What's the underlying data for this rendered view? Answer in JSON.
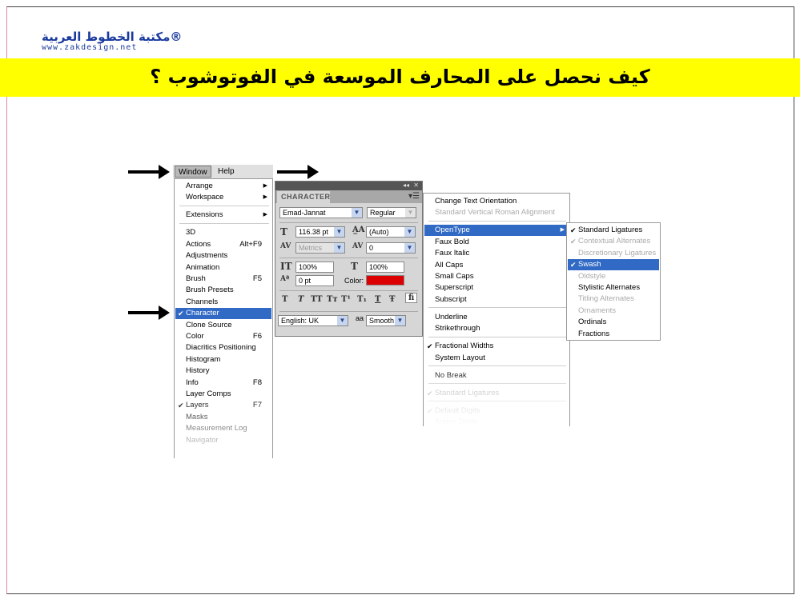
{
  "logo": {
    "arabic": "مكتبة الخطوط العربية®",
    "url": "www.zakdesign.net"
  },
  "banner": {
    "title": "كيف نحصل على المحارف الموسعة في الفوتوشوب ؟",
    "color": "#ffff00"
  },
  "menubar": {
    "window": "Window",
    "help": "Help"
  },
  "window_menu": [
    {
      "label": "Arrange",
      "submenu": true
    },
    {
      "label": "Workspace",
      "submenu": true
    },
    {
      "sep": true
    },
    {
      "label": "Extensions",
      "submenu": true
    },
    {
      "sep": true
    },
    {
      "label": "3D"
    },
    {
      "label": "Actions",
      "shortcut": "Alt+F9"
    },
    {
      "label": "Adjustments"
    },
    {
      "label": "Animation"
    },
    {
      "label": "Brush",
      "shortcut": "F5"
    },
    {
      "label": "Brush Presets"
    },
    {
      "label": "Channels"
    },
    {
      "label": "Character",
      "checked": true,
      "highlight": true
    },
    {
      "label": "Clone Source"
    },
    {
      "label": "Color",
      "shortcut": "F6"
    },
    {
      "label": "Diacritics Positioning"
    },
    {
      "label": "Histogram"
    },
    {
      "label": "History"
    },
    {
      "label": "Info",
      "shortcut": "F8"
    },
    {
      "label": "Layer Comps"
    },
    {
      "label": "Layers",
      "shortcut": "F7",
      "checked": true
    },
    {
      "label": "Masks"
    },
    {
      "label": "Measurement Log"
    },
    {
      "label": "Navigator"
    }
  ],
  "character_panel": {
    "title": "CHARACTER",
    "font_family": "Emad-Jannat",
    "font_style": "Regular",
    "font_size": "116.38 pt",
    "leading": "(Auto)",
    "kerning": "Metrics",
    "tracking": "0",
    "vertical_scale": "100%",
    "horizontal_scale": "100%",
    "baseline_shift": "0 pt",
    "color_label": "Color:",
    "color": "#dd0000",
    "style_buttons": [
      "T",
      "T",
      "TT",
      "Tт",
      "T¹",
      "T₁",
      "T",
      "Ŧ",
      "fi"
    ],
    "language": "English: UK",
    "aa_label": "aa",
    "antialias": "Smooth"
  },
  "flyout_menu": [
    {
      "label": "Change Text Orientation"
    },
    {
      "label": "Standard Vertical Roman Alignment",
      "disabled": true
    },
    {
      "sep": true
    },
    {
      "label": "OpenType",
      "submenu": true,
      "highlight": true
    },
    {
      "label": "Faux Bold"
    },
    {
      "label": "Faux Italic"
    },
    {
      "label": "All Caps"
    },
    {
      "label": "Small Caps"
    },
    {
      "label": "Superscript"
    },
    {
      "label": "Subscript"
    },
    {
      "sep": true
    },
    {
      "label": "Underline"
    },
    {
      "label": "Strikethrough"
    },
    {
      "sep": true
    },
    {
      "label": "Fractional Widths",
      "checked": true
    },
    {
      "label": "System Layout"
    },
    {
      "sep": true
    },
    {
      "label": "No Break"
    },
    {
      "sep": true
    },
    {
      "label": "Standard Ligatures",
      "checked": true,
      "disabled": true
    },
    {
      "sep": true
    },
    {
      "label": "Default Digits",
      "checked": true,
      "disabled": true
    },
    {
      "label": "Arabic Digits",
      "disabled": true
    }
  ],
  "opentype_menu": [
    {
      "label": "Standard Ligatures",
      "checked": true
    },
    {
      "label": "Contextual Alternates",
      "checked": true,
      "disabled": true
    },
    {
      "label": "Discretionary Ligatures",
      "disabled": true
    },
    {
      "label": "Swash",
      "checked": true,
      "highlight": true
    },
    {
      "label": "Oldstyle",
      "disabled": true
    },
    {
      "label": "Stylistic Alternates"
    },
    {
      "label": "Titling Alternates",
      "disabled": true
    },
    {
      "label": "Ornaments",
      "disabled": true
    },
    {
      "label": "Ordinals"
    },
    {
      "label": "Fractions"
    }
  ]
}
